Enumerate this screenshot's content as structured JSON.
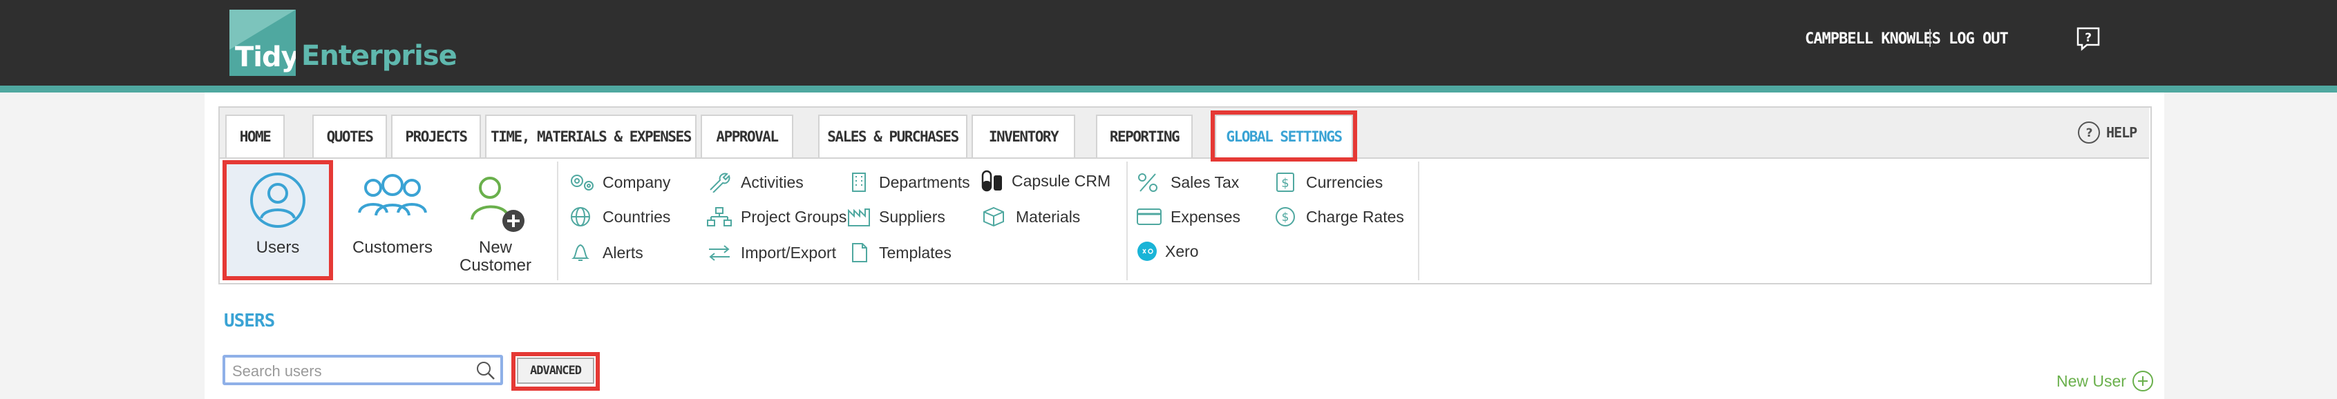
{
  "brand": {
    "logo_word": "Tidy",
    "logo_suffix": "Enterprise"
  },
  "header": {
    "user_name": "CAMPBELL KNOWLES",
    "logout_label": "LOG OUT"
  },
  "tabs": [
    {
      "label": "HOME"
    },
    {
      "label": "QUOTES"
    },
    {
      "label": "PROJECTS"
    },
    {
      "label": "TIME, MATERIALS & EXPENSES"
    },
    {
      "label": "APPROVAL"
    },
    {
      "label": "SALES & PURCHASES"
    },
    {
      "label": "INVENTORY"
    },
    {
      "label": "REPORTING"
    },
    {
      "label": "GLOBAL SETTINGS"
    }
  ],
  "help_label": "HELP",
  "submenu": {
    "users": "Users",
    "customers": "Customers",
    "new_customer_line1": "New",
    "new_customer_line2": "Customer",
    "company": "Company",
    "countries": "Countries",
    "alerts": "Alerts",
    "activities": "Activities",
    "project_groups": "Project Groups",
    "import_export": "Import/Export",
    "departments": "Departments",
    "suppliers": "Suppliers",
    "templates": "Templates",
    "capsule_crm": "Capsule CRM",
    "materials": "Materials",
    "sales_tax": "Sales Tax",
    "expenses": "Expenses",
    "xero": "Xero",
    "currencies": "Currencies",
    "charge_rates": "Charge Rates"
  },
  "section": {
    "title": "USERS",
    "search_placeholder": "Search users",
    "advanced_label": "ADVANCED",
    "new_user_label": "New User"
  },
  "colors": {
    "accent": "#3aa3d4",
    "brand": "#4fa8a0",
    "highlight": "#e53935",
    "new_user": "#6ab04c"
  }
}
